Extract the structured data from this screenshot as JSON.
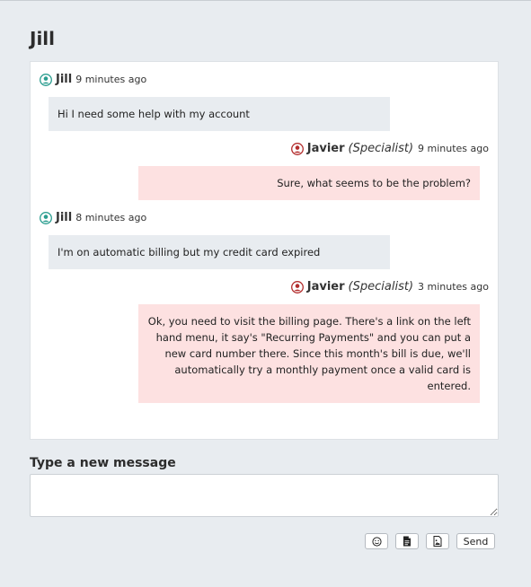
{
  "page": {
    "title": "Jill"
  },
  "thread": {
    "messages": [
      {
        "sender": "Jill",
        "role": "",
        "time": "9 minutes ago",
        "side": "customer",
        "text": "Hi I need some help with my account"
      },
      {
        "sender": "Javier",
        "role": "(Specialist)",
        "time": "9 minutes ago",
        "side": "agent",
        "text": "Sure, what seems to be the problem?"
      },
      {
        "sender": "Jill",
        "role": "",
        "time": "8 minutes ago",
        "side": "customer",
        "text": "I'm on automatic billing but my credit card expired"
      },
      {
        "sender": "Javier",
        "role": "(Specialist)",
        "time": "3 minutes ago",
        "side": "agent",
        "text": "Ok, you need to visit the billing page. There's a link on the left hand menu, it say's \"Recurring Payments\" and you can put a new card number there. Since this month's bill is due, we'll automatically try a monthly payment once a valid card is entered."
      }
    ]
  },
  "composer": {
    "label": "Type a new message",
    "value": "",
    "emoji_icon": "smiley-icon",
    "file_icon": "document-icon",
    "image_icon": "image-icon",
    "send_label": "Send"
  },
  "colors": {
    "customer_icon": "#2a9d8f",
    "agent_icon": "#b32d2d",
    "customer_bubble": "#e8ecf0",
    "agent_bubble": "#fde1e1"
  }
}
